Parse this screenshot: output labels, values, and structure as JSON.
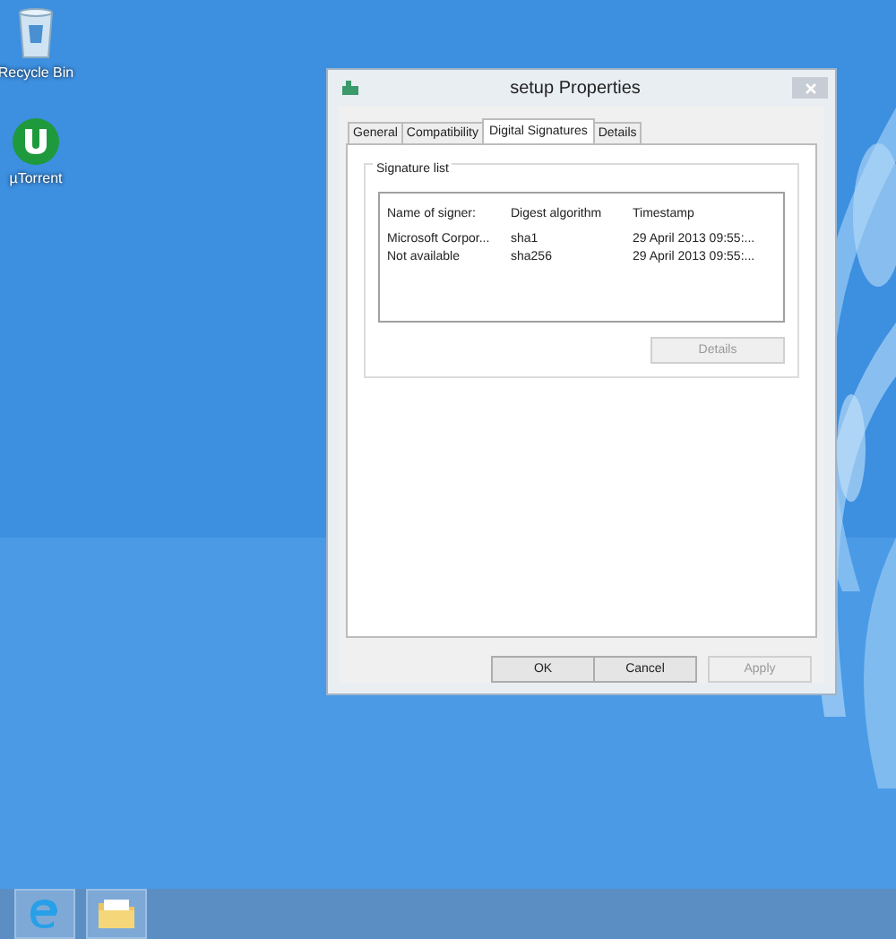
{
  "desktop_icons": [
    {
      "kind": "recycle",
      "label": "Recycle Bin"
    },
    {
      "kind": "torrent",
      "label": "µTorrent"
    }
  ],
  "window": {
    "title": "setup Properties",
    "tabs": [
      {
        "label": "General",
        "selected": false
      },
      {
        "label": "Compatibility",
        "selected": false
      },
      {
        "label": "Digital Signatures",
        "selected": true
      },
      {
        "label": "Details",
        "selected": false
      }
    ],
    "group_title": "Signature list",
    "table": {
      "columns": [
        "Name of signer:",
        "Digest algorithm",
        "Timestamp"
      ],
      "rows": [
        [
          "Microsoft Corpor...",
          "sha1",
          "29 April 2013 09:55:..."
        ],
        [
          "Not available",
          "sha256",
          "29 April 2013 09:55:..."
        ]
      ]
    },
    "details_button": {
      "label": "Details",
      "disabled": true
    },
    "buttons": [
      {
        "label": "OK",
        "disabled": false
      },
      {
        "label": "Cancel",
        "disabled": false
      },
      {
        "label": "Apply",
        "disabled": true
      }
    ]
  },
  "taskbar": [
    {
      "kind": "browser"
    },
    {
      "kind": "folder"
    }
  ]
}
